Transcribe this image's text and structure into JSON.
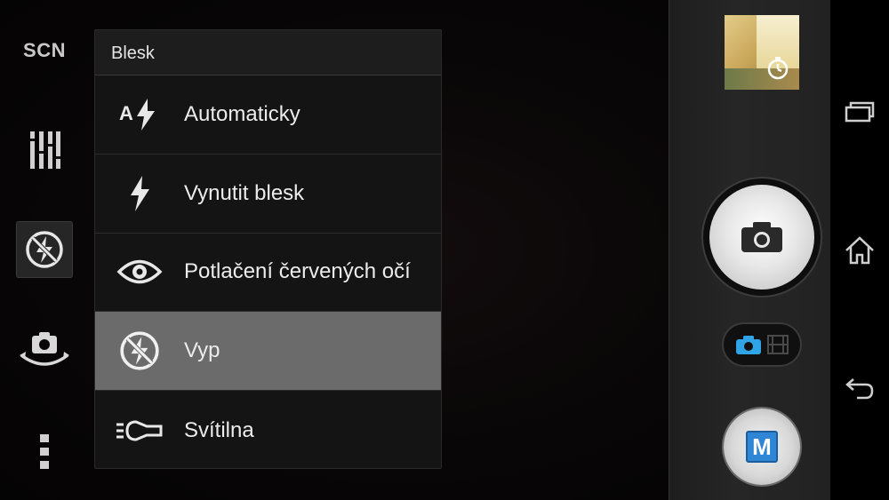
{
  "left_toolbar": {
    "scene_label": "SCN",
    "items": [
      {
        "icon": "scene-icon"
      },
      {
        "icon": "settings-sliders-icon"
      },
      {
        "icon": "flash-off-icon",
        "active": true
      },
      {
        "icon": "switch-camera-icon"
      },
      {
        "icon": "more-icon"
      }
    ]
  },
  "flash_menu": {
    "title": "Blesk",
    "items": [
      {
        "label": "Automaticky",
        "icon": "flash-auto-icon",
        "selected": false
      },
      {
        "label": "Vynutit blesk",
        "icon": "flash-on-icon",
        "selected": false
      },
      {
        "label": "Potlačení červených očí",
        "icon": "red-eye-icon",
        "selected": false
      },
      {
        "label": "Vyp",
        "icon": "flash-off-icon",
        "selected": true
      },
      {
        "label": "Svítilna",
        "icon": "torch-icon",
        "selected": false
      }
    ]
  },
  "right_panel": {
    "thumbnail_icon": "self-timer-icon",
    "shutter_icon": "camera-icon",
    "mode_toggle": {
      "photo_icon": "camera-icon",
      "video_icon": "film-icon",
      "active": "photo"
    },
    "manual_label": "M"
  },
  "nav_bar": {
    "items": [
      {
        "icon": "recent-apps-icon"
      },
      {
        "icon": "home-icon"
      },
      {
        "icon": "back-icon"
      }
    ]
  },
  "colors": {
    "accent": "#2f86d6",
    "selected_row": "#6b6b6b",
    "menu_bg": "#141414"
  }
}
